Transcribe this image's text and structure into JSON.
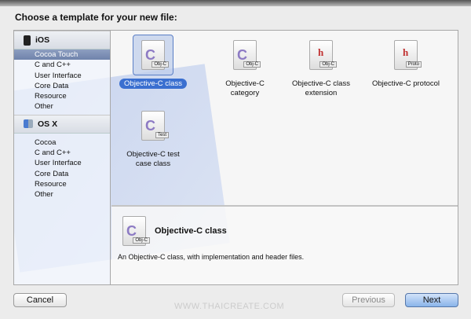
{
  "title": "Choose a template for your new file:",
  "sidebar": {
    "ios": {
      "label": "iOS",
      "items": [
        "Cocoa Touch",
        "C and C++",
        "User Interface",
        "Core Data",
        "Resource",
        "Other"
      ]
    },
    "osx": {
      "label": "OS X",
      "items": [
        "Cocoa",
        "C and C++",
        "User Interface",
        "Core Data",
        "Resource",
        "Other"
      ]
    }
  },
  "templates": [
    {
      "label": "Objective-C class",
      "tag": "Obj-C",
      "glyph": "C"
    },
    {
      "label": "Objective-C category",
      "tag": "Obj-C",
      "glyph": "C"
    },
    {
      "label": "Objective-C class extension",
      "tag": "Obj-C",
      "glyph": "h"
    },
    {
      "label": "Objective-C protocol",
      "tag": "Proto",
      "glyph": "h"
    },
    {
      "label": "Objective-C test case class",
      "tag": "Test",
      "glyph": "C"
    }
  ],
  "detail": {
    "title": "Objective-C class",
    "tag": "Obj-C",
    "glyph": "C",
    "description": "An Objective-C class, with implementation and header files."
  },
  "buttons": {
    "cancel": "Cancel",
    "previous": "Previous",
    "next": "Next"
  },
  "watermark": "WWW.THAICREATE.COM"
}
